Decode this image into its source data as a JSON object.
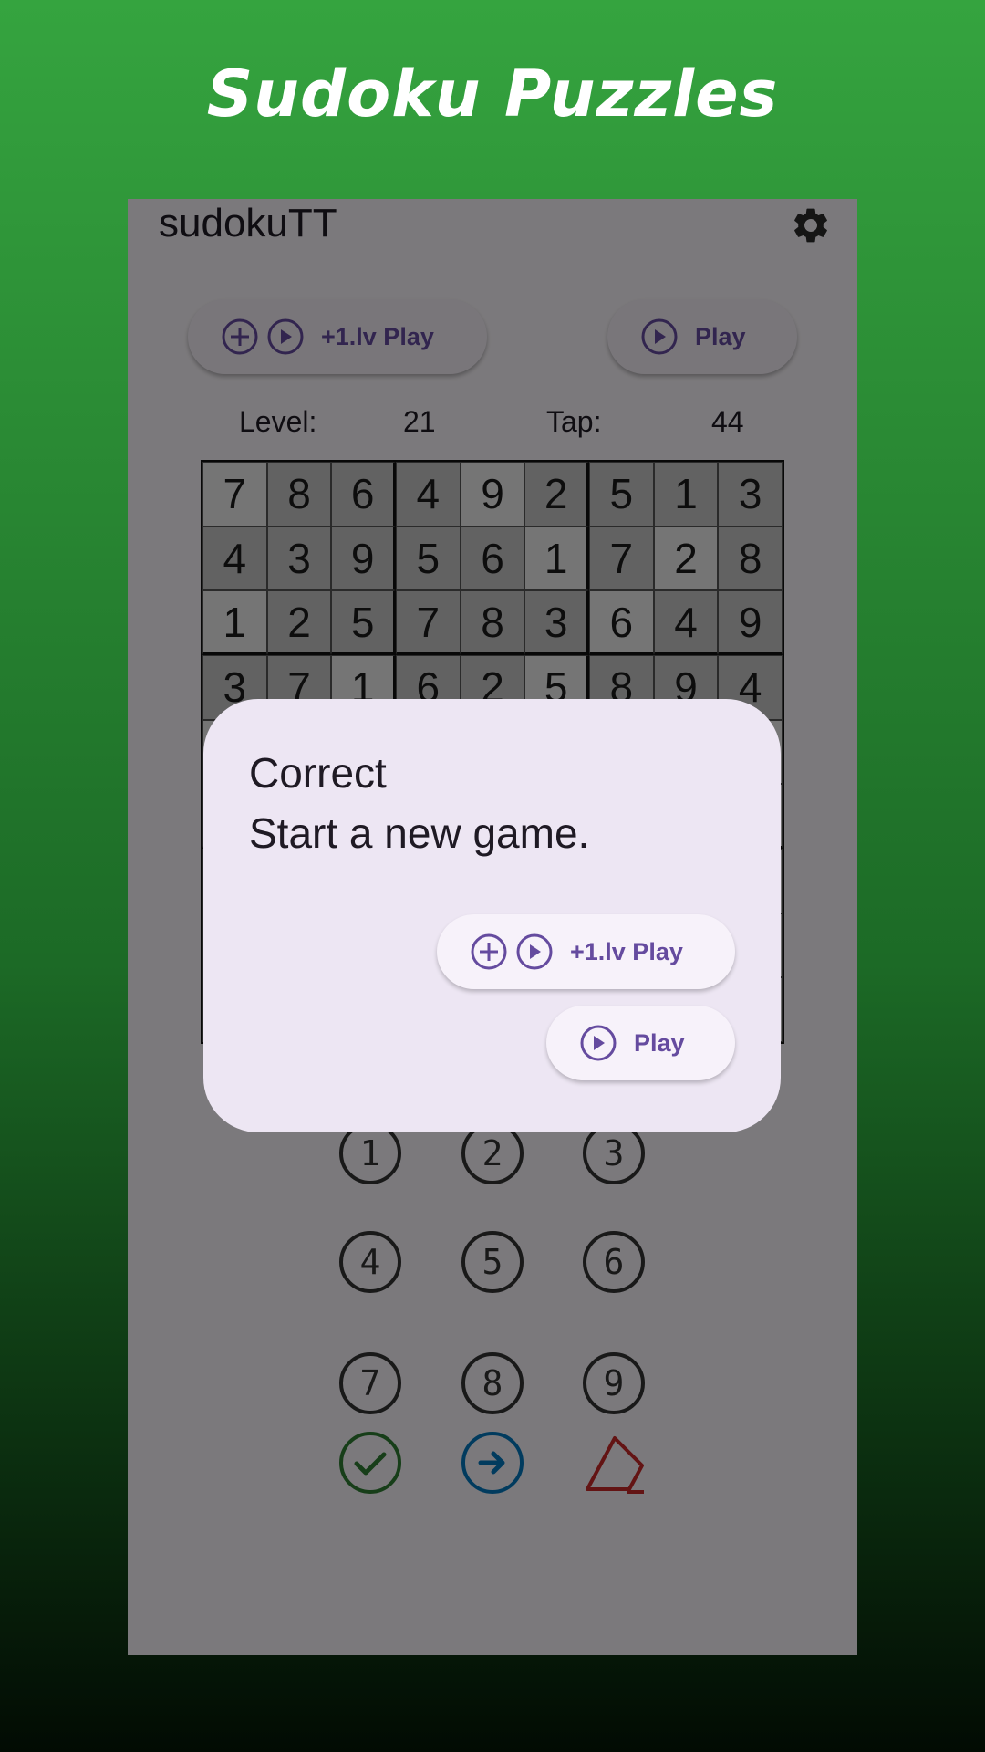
{
  "promo": {
    "title": "Sudoku Puzzles"
  },
  "app": {
    "title": "sudokuTT",
    "settings_icon": "gear-icon"
  },
  "toolbar": {
    "level_play_label": "+1.lv Play",
    "play_label": "Play"
  },
  "stats": {
    "level_label": "Level:",
    "level_value": "21",
    "tap_label": "Tap:",
    "tap_value": "44"
  },
  "grid": {
    "rows": [
      [
        "7",
        "8",
        "6",
        "4",
        "9",
        "2",
        "5",
        "1",
        "3"
      ],
      [
        "4",
        "3",
        "9",
        "5",
        "6",
        "1",
        "7",
        "2",
        "8"
      ],
      [
        "1",
        "2",
        "5",
        "7",
        "8",
        "3",
        "6",
        "4",
        "9"
      ],
      [
        "3",
        "7",
        "1",
        "6",
        "2",
        "5",
        "8",
        "9",
        "4"
      ],
      [
        "",
        "",
        "",
        "",
        "",
        "",
        "",
        "",
        ""
      ],
      [
        "",
        "",
        "",
        "",
        "",
        "",
        "",
        "",
        ""
      ],
      [
        "",
        "",
        "",
        "",
        "",
        "",
        "",
        "",
        ""
      ],
      [
        "",
        "",
        "",
        "",
        "",
        "",
        "",
        "",
        ""
      ],
      [
        "",
        "",
        "",
        "",
        "",
        "",
        "",
        "",
        ""
      ]
    ],
    "shades": [
      [
        "l",
        "d",
        "d",
        "d",
        "l",
        "d",
        "d",
        "d",
        "d"
      ],
      [
        "d",
        "d",
        "d",
        "d",
        "d",
        "l",
        "d",
        "l",
        "d"
      ],
      [
        "l",
        "d",
        "d",
        "d",
        "d",
        "d",
        "l",
        "d",
        "d"
      ],
      [
        "d",
        "d",
        "l",
        "d",
        "d",
        "l",
        "d",
        "d",
        "d"
      ],
      [
        "l",
        "l",
        "l",
        "l",
        "l",
        "l",
        "l",
        "l",
        "l"
      ],
      [
        "l",
        "l",
        "l",
        "l",
        "l",
        "l",
        "l",
        "l",
        "l"
      ],
      [
        "l",
        "l",
        "l",
        "l",
        "l",
        "l",
        "l",
        "l",
        "l"
      ],
      [
        "l",
        "l",
        "l",
        "l",
        "l",
        "l",
        "l",
        "l",
        "l"
      ],
      [
        "l",
        "l",
        "l",
        "l",
        "l",
        "l",
        "l",
        "l",
        "l"
      ]
    ]
  },
  "numpad": {
    "keys": [
      "1",
      "2",
      "3",
      "4",
      "5",
      "6",
      "7",
      "8",
      "9"
    ]
  },
  "actions": {
    "check_icon": "check-circle-icon",
    "next_icon": "arrow-right-circle-icon",
    "erase_icon": "eraser-icon"
  },
  "dialog": {
    "title": "Correct",
    "message": "Start a new game.",
    "level_play_label": "+1.lv Play",
    "play_label": "Play"
  },
  "colors": {
    "accent": "#654b9f",
    "check": "#2e7d32",
    "next": "#0277bd",
    "erase": "#c62828"
  }
}
